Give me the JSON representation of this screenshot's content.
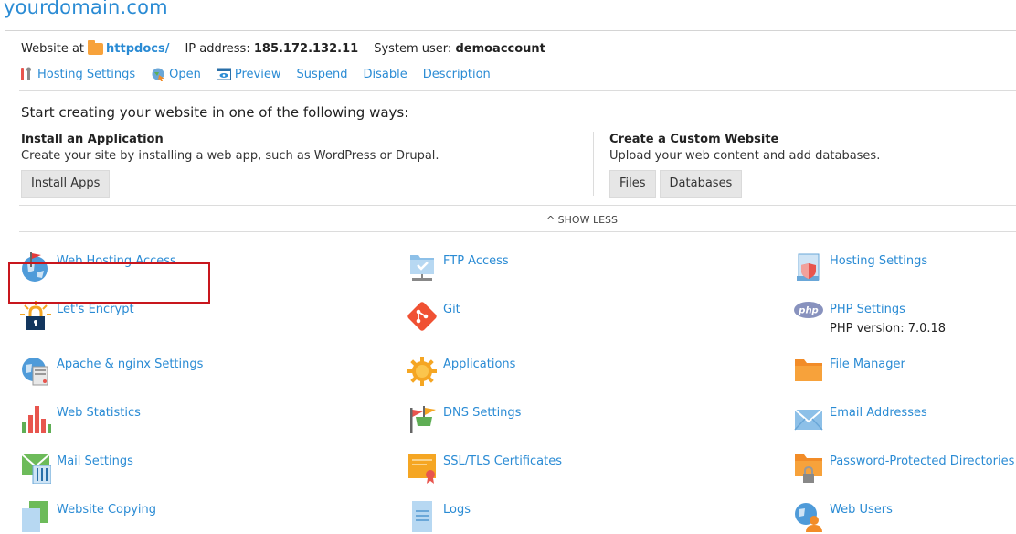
{
  "domain_title": "yourdomain.com",
  "info": {
    "website_at_label": "Website at",
    "folder_name": "httpdocs/",
    "ip_label": "IP address:",
    "ip_value": "185.172.132.11",
    "user_label": "System user:",
    "user_value": "demoaccount"
  },
  "actions": {
    "hosting_settings": "Hosting Settings",
    "open": "Open",
    "preview": "Preview",
    "suspend": "Suspend",
    "disable": "Disable",
    "description": "Description"
  },
  "start": {
    "title": "Start creating your website in one of the following ways:",
    "install": {
      "heading": "Install an Application",
      "desc": "Create your site by installing a web app, such as WordPress or Drupal.",
      "button": "Install Apps"
    },
    "custom": {
      "heading": "Create a Custom Website",
      "desc": "Upload your web content and add databases.",
      "files_button": "Files",
      "databases_button": "Databases"
    }
  },
  "show_less": "^ SHOW LESS",
  "tools": {
    "web_hosting_access": "Web Hosting Access",
    "ftp_access": "FTP Access",
    "hosting_settings": "Hosting Settings",
    "lets_encrypt": "Let's Encrypt",
    "git": "Git",
    "php_settings": "PHP Settings",
    "php_version": "PHP version: 7.0.18",
    "apache_nginx": "Apache & nginx Settings",
    "applications": "Applications",
    "file_manager": "File Manager",
    "web_statistics": "Web Statistics",
    "dns_settings": "DNS Settings",
    "email_addresses": "Email Addresses",
    "mail_settings": "Mail Settings",
    "ssl_tls": "SSL/TLS Certificates",
    "password_dirs": "Password-Protected Directories",
    "website_copying": "Website Copying",
    "logs": "Logs",
    "web_users": "Web Users"
  },
  "colors": {
    "link": "#2a8bd4",
    "highlight_border": "#c8161d",
    "folder": "#f7a23b"
  }
}
